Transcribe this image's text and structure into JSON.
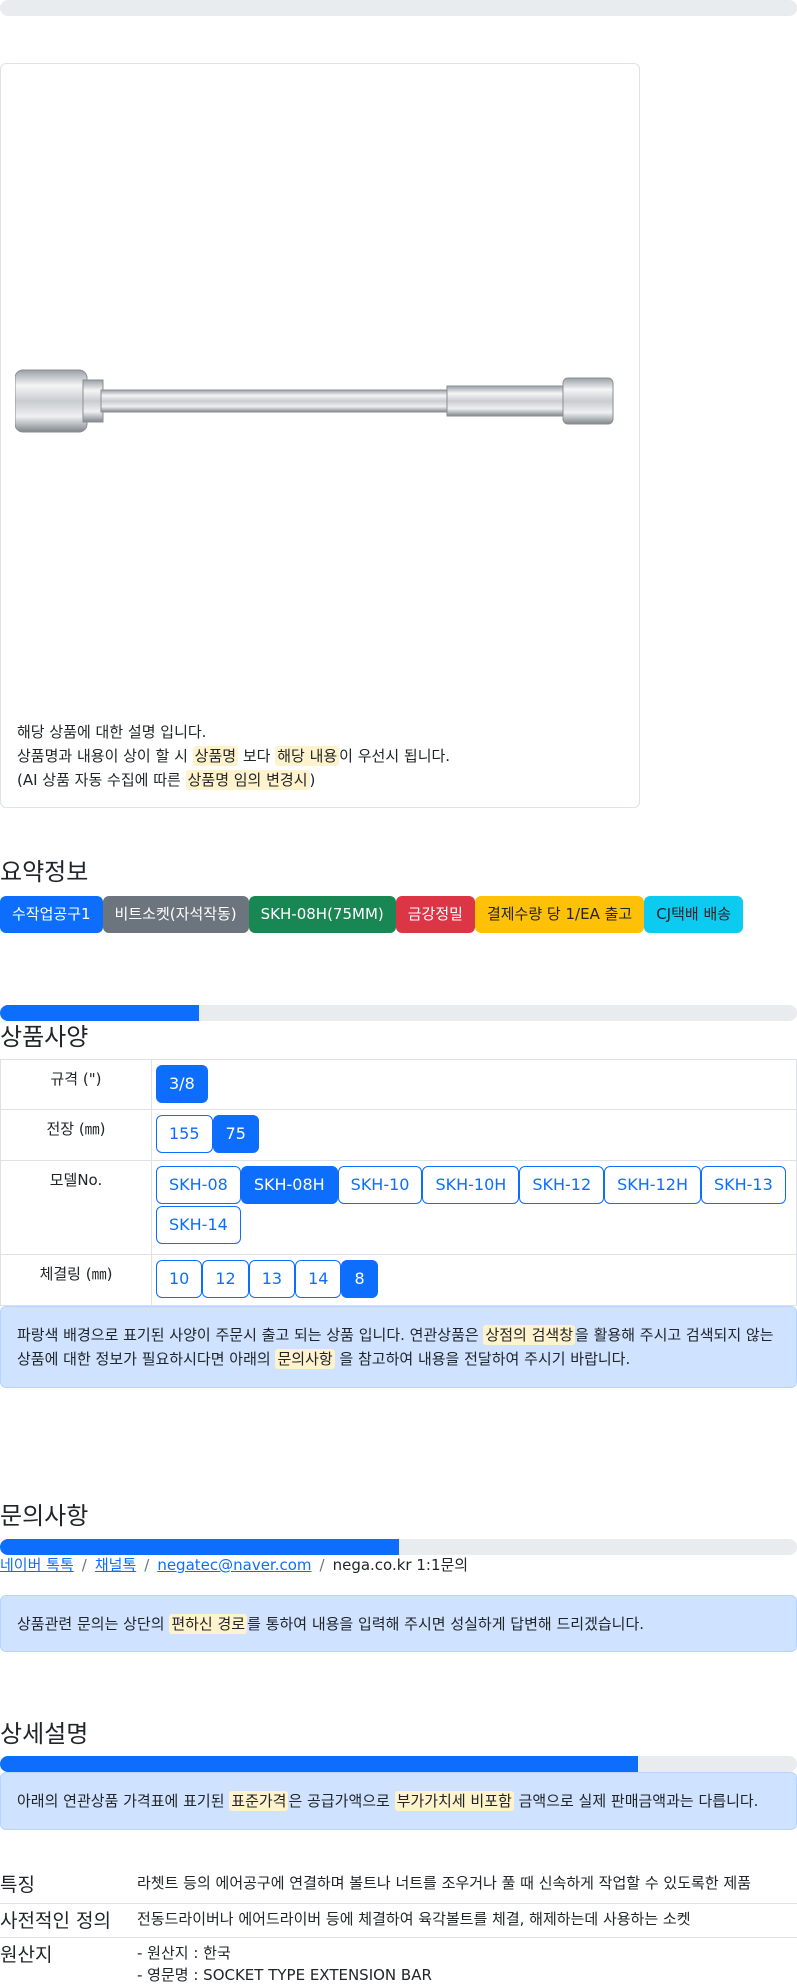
{
  "product_image": {
    "description": [
      "해당 상품에 대한 설명 입니다.",
      "상품명과 내용이 상이 할 시 ",
      "상품명",
      " 보다 ",
      "해당 내용",
      "이 우선시 됩니다.",
      "(AI 상품 자동 수집에 따른 ",
      "상품명 임의 변경시",
      ")"
    ]
  },
  "summary": {
    "title": "요약정보",
    "badges": [
      {
        "label": "수작업공구1",
        "color": "#0d6efd"
      },
      {
        "label": "비트소켓(자석작동)",
        "color": "#6c757d"
      },
      {
        "label": "SKH-08H(75MM)",
        "color": "#198754"
      },
      {
        "label": "금강정밀",
        "color": "#dc3545"
      },
      {
        "label": "결제수량 당 1/EA 출고",
        "color": "#ffc107"
      },
      {
        "label": "CJ택배 배송",
        "color": "#0dcaf0"
      }
    ]
  },
  "specs": {
    "title": "상품사양",
    "progress": 0.25,
    "rows": [
      {
        "label": "규격 (\")",
        "options": [
          "3/8"
        ],
        "active": [
          "3/8"
        ]
      },
      {
        "label": "전장 (㎜)",
        "options": [
          "155",
          "75"
        ],
        "active": [
          "75"
        ]
      },
      {
        "label": "모델No.",
        "options": [
          "SKH-08",
          "SKH-08H",
          "SKH-10",
          "SKH-10H",
          "SKH-12",
          "SKH-12H",
          "SKH-13",
          "SKH-14"
        ],
        "active": [
          "SKH-08H"
        ]
      },
      {
        "label": "체결링 (㎜)",
        "options": [
          "10",
          "12",
          "13",
          "14",
          "8"
        ],
        "active": [
          "8"
        ]
      }
    ],
    "notice": [
      "파랑색 배경으로 표기된 사양이 주문시 출고 되는 상품 입니다. 연관상품은 ",
      "상점의 검색창",
      "을 활용해 주시고 검색되지 않는 상품에 대한 정보가 필요하시다면 아래의 ",
      "문의사항",
      " 을 참고하여 내용을 전달하여 주시기 바랍니다."
    ]
  },
  "inquiry": {
    "title": "문의사항",
    "progress": 0.5,
    "links": [
      "네이버 톡톡",
      "채널톡",
      "negatec@naver.com"
    ],
    "plain": "nega.co.kr 1:1문의",
    "notice": [
      "상품관련 문의는 상단의 ",
      "편하신 경로",
      "를 통하여 내용을 입력해 주시면 성실하게 답변해 드리겠습니다."
    ]
  },
  "detail": {
    "title": "상세설명",
    "progress": 0.8,
    "notice": [
      "아래의 연관상품 가격표에 표기된 ",
      "표준가격",
      "은 공급가액으로 ",
      "부가가치세 비포함",
      " 금액으로 실제 판매금액과는 다릅니다."
    ],
    "info": [
      {
        "key": "특징",
        "value": [
          "라쳇트 등의 에어공구에 연결하며 볼트나 너트를 조우거나 풀 때 신속하게 작업할 수 있도록한 제품"
        ]
      },
      {
        "key": "사전적인 정의",
        "value": [
          "전동드라이버나 에어드라이버 등에 체결하여 육각볼트를 체결, 해제하는데 사용하는 소켓"
        ]
      },
      {
        "key": "원산지",
        "value": [
          "- 원산지 : 한국",
          "- 영문명 : SOCKET TYPE EXTENSION BAR"
        ]
      }
    ]
  }
}
